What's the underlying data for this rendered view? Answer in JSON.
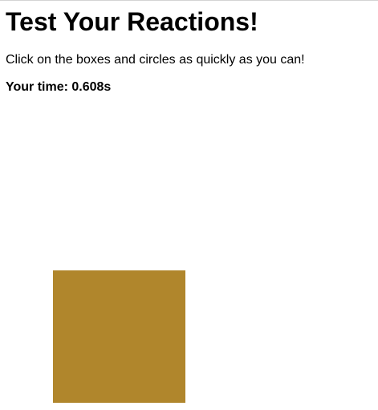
{
  "page": {
    "title": "Test Your Reactions!",
    "instructions": "Click on the boxes and circles as quickly as you can!",
    "time_text": "Your time: 0.608s"
  },
  "target": {
    "shape": "square",
    "color": "#b0862c"
  },
  "colors": {
    "background": "#ffffff",
    "text": "#000000"
  }
}
